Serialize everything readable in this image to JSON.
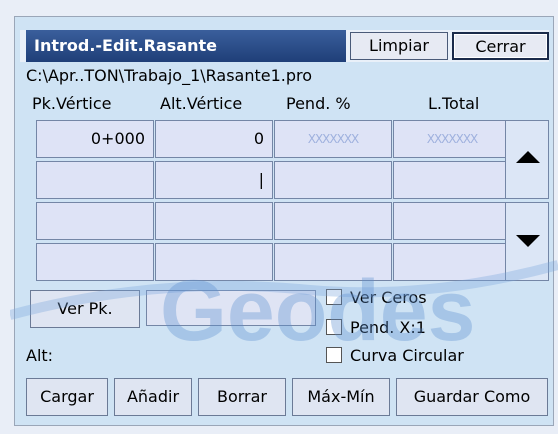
{
  "window": {
    "title": "Introd.-Edit.Rasante",
    "clear_label": "Limpiar",
    "close_label": "Cerrar"
  },
  "file_path": "C:\\Apr..TON\\Trabajo_1\\Rasante1.pro",
  "table": {
    "headers": [
      "Pk.Vértice",
      "Alt.Vértice",
      "Pend. %",
      "L.Total"
    ],
    "rows": [
      [
        "0+000",
        "0",
        "XXXXXXX",
        "XXXXXXX"
      ],
      [
        "",
        "|",
        "",
        ""
      ],
      [
        "",
        "",
        "",
        ""
      ],
      [
        "",
        "",
        "",
        ""
      ]
    ]
  },
  "ver_pk": {
    "label": "Ver Pk.",
    "value": ""
  },
  "options": {
    "ver_ceros": "Ver Ceros",
    "pend_x1": "Pend. X:1",
    "curva_circular": "Curva Circular"
  },
  "alt_label": "Alt:",
  "actions": {
    "cargar": "Cargar",
    "anadir": "Añadir",
    "borrar": "Borrar",
    "max_min": "Máx-Mín",
    "guardar_como": "Guardar Como"
  },
  "watermark": "Geodes",
  "colors": {
    "title_bg": "#2b4c88",
    "cell_bg": "#dee3f6",
    "watermark": "#5b8fd0"
  }
}
